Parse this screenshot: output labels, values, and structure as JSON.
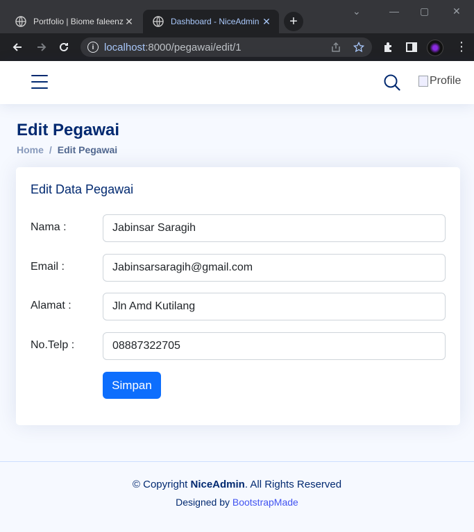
{
  "browser": {
    "tabs": [
      {
        "title": "Portfolio | Biome faleenz",
        "active": false
      },
      {
        "title": "Dashboard - NiceAdmin",
        "active": true
      }
    ],
    "url_host": "localhost",
    "url_path": ":8000/pegawai/edit/1"
  },
  "header": {
    "profile_alt": "Profile"
  },
  "pagetitle": {
    "title": "Edit Pegawai",
    "breadcrumb_home": "Home",
    "breadcrumb_sep": "/",
    "breadcrumb_current": "Edit Pegawai"
  },
  "form": {
    "title": "Edit Data Pegawai",
    "fields": [
      {
        "label": "Nama :",
        "value": "Jabinsar Saragih"
      },
      {
        "label": "Email :",
        "value": "Jabinsarsaragih@gmail.com"
      },
      {
        "label": "Alamat :",
        "value": "Jln Amd Kutilang"
      },
      {
        "label": "No.Telp :",
        "value": "08887322705"
      }
    ],
    "submit_label": "Simpan"
  },
  "footer": {
    "copyright_prefix": "© Copyright ",
    "brand": "NiceAdmin",
    "copyright_suffix": ". All Rights Reserved",
    "designed_by": "Designed by ",
    "designer": "BootstrapMade"
  },
  "colors": {
    "primary": "#012970",
    "button": "#0d6efd",
    "link": "#4154f1"
  }
}
